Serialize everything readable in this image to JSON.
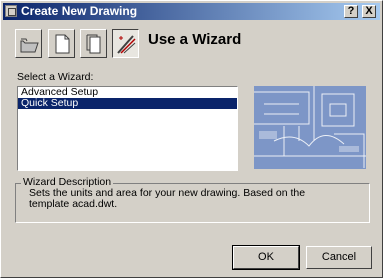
{
  "titlebar": {
    "title": "Create New Drawing",
    "help_label": "?",
    "close_label": "X"
  },
  "modes": [
    {
      "icon": "open-folder-icon"
    },
    {
      "icon": "blank-page-icon"
    },
    {
      "icon": "template-page-icon"
    },
    {
      "icon": "wizard-wand-icon",
      "pressed": true
    }
  ],
  "heading": "Use a Wizard",
  "wizard_label": "Select a Wizard:",
  "wizards": [
    {
      "label": "Advanced Setup",
      "selected": false
    },
    {
      "label": "Quick Setup",
      "selected": true
    }
  ],
  "description": {
    "title": "Wizard Description",
    "text": "Sets the units and area for your new drawing. Based on the template acad.dwt."
  },
  "buttons": {
    "ok": "OK",
    "cancel": "Cancel"
  },
  "colors": {
    "selection": "#0a246a",
    "preview_blue": "#7d96c7"
  }
}
